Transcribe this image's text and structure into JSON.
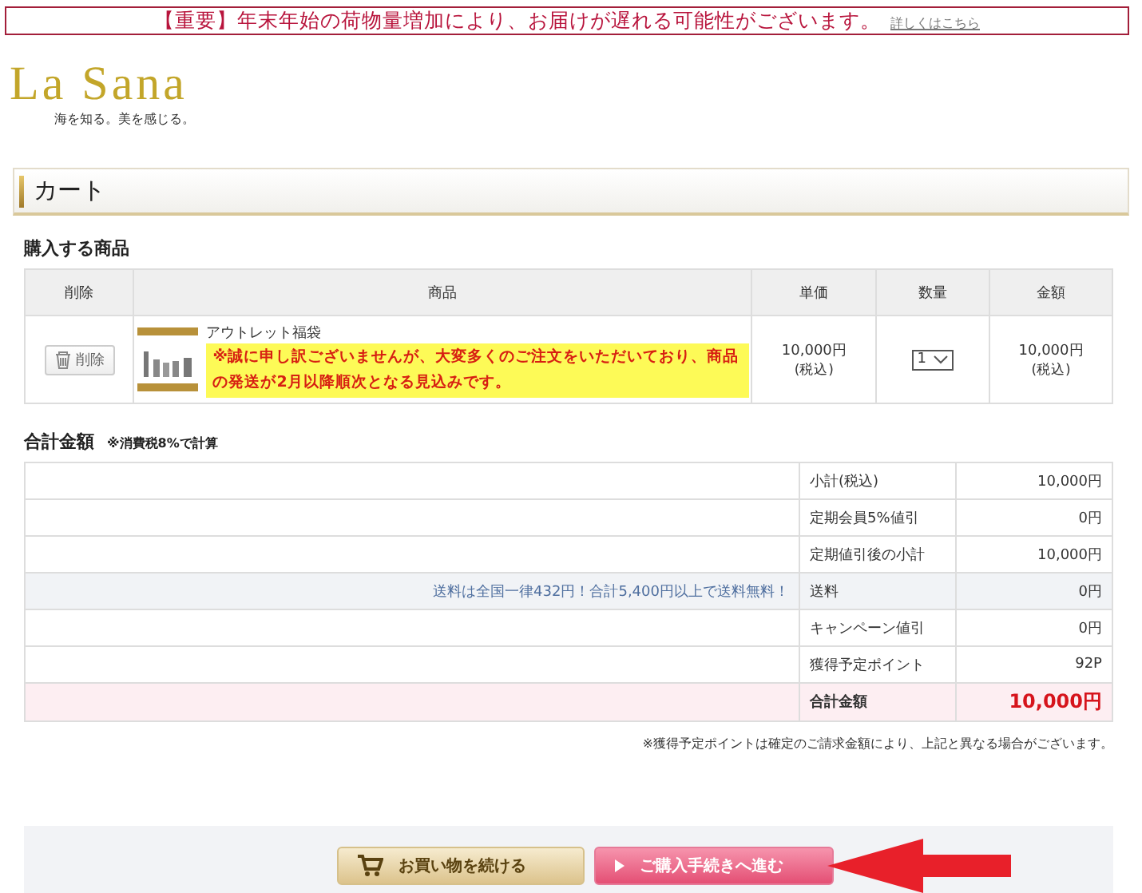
{
  "notice": {
    "text": "【重要】年末年始の荷物量増加により、お届けが遅れる可能性がございます。",
    "link": "詳しくはこちら"
  },
  "logo": {
    "name": "La Sana",
    "tagline": "海を知る。美を感じる。"
  },
  "page_title": "カート",
  "cart": {
    "heading": "購入する商品",
    "columns": [
      "削除",
      "商品",
      "単価",
      "数量",
      "金額"
    ],
    "items": [
      {
        "delete_label": "削除",
        "name": "アウトレット福袋",
        "note": "※誠に申し訳ございませんが、大変多くのご注文をいただいており、商品の発送が2月以降順次となる見込みです。",
        "unit_price": "10,000円",
        "unit_tax": "(税込)",
        "quantity": "1",
        "amount": "10,000円",
        "amount_tax": "(税込)"
      }
    ]
  },
  "totals": {
    "heading": "合計金額",
    "tax_note": "※消費税8%で計算",
    "rows": [
      {
        "kind": "normal",
        "label": "小計(税込)",
        "value": "10,000円"
      },
      {
        "kind": "normal",
        "label": "定期会員5%値引",
        "value": "0円"
      },
      {
        "kind": "normal",
        "label": "定期値引後の小計",
        "value": "10,000円"
      },
      {
        "kind": "normal",
        "note": "送料は全国一律432円！合計5,400円以上で送料無料！",
        "label": "送料",
        "value": "0円"
      },
      {
        "kind": "normal",
        "label": "キャンペーン値引",
        "value": "0円"
      },
      {
        "kind": "normal",
        "label": "獲得予定ポイント",
        "value": "92P"
      },
      {
        "kind": "total",
        "label": "合計金額",
        "value": "10,000円"
      }
    ],
    "footnote": "※獲得予定ポイントは確定のご請求金額により、上記と異なる場合がございます。"
  },
  "buttons": [
    {
      "kind": "continue",
      "label": "お買い物を続ける"
    },
    {
      "kind": "checkout",
      "label": "ご購入手続きへ進む"
    }
  ]
}
